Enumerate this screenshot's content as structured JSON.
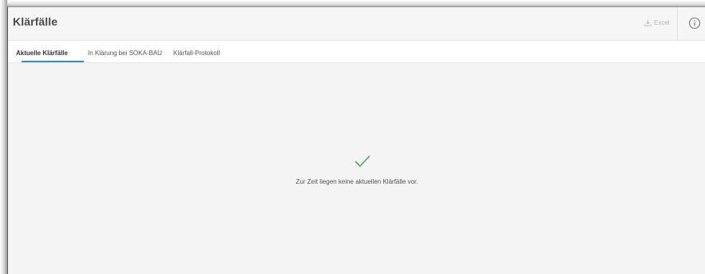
{
  "header": {
    "title": "Klärfälle",
    "excel_label": "Excel"
  },
  "tabs": [
    {
      "label": "Aktuelle Klärfälle",
      "active": true
    },
    {
      "label": "In Klärung bei SOKA-BAU",
      "active": false
    },
    {
      "label": "Klärfall-Protokoll",
      "active": false
    }
  ],
  "content": {
    "status_icon": "checkmark-icon",
    "message": "Zur Zeit liegen keine aktuellen Klärfälle vor."
  },
  "colors": {
    "accent": "#2d8fd5",
    "success": "#4caf50",
    "muted": "#b5b5b5"
  }
}
